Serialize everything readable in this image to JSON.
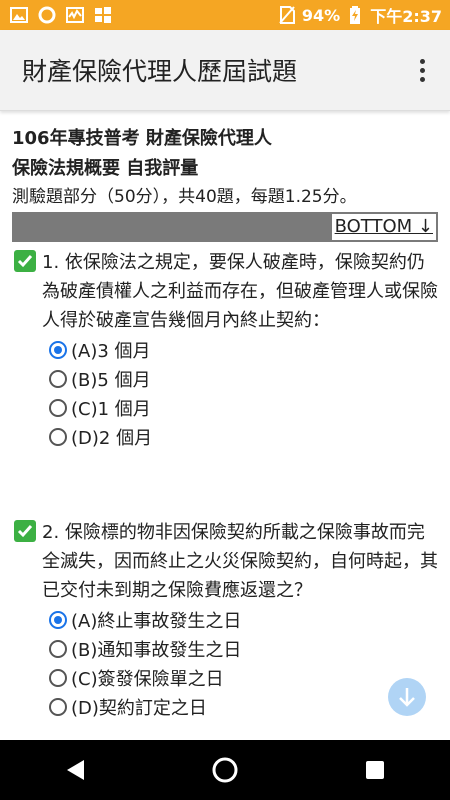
{
  "status": {
    "battery": "94%",
    "time": "下午2:37"
  },
  "app_bar": {
    "title": "財產保險代理人歷屆試題"
  },
  "exam": {
    "title": "106年專技普考 財產保險代理人",
    "subject": "保險法規概要 自我評量",
    "info": "測驗題部分（50分），共40題，每題1.25分。",
    "bottom_link": "BOTTOM ↓"
  },
  "questions": [
    {
      "text": "1. 依保險法之規定，要保人破產時，保險契約仍為破產債權人之利益而存在，但破產管理人或保險人得於破產宣告幾個月內終止契約：",
      "options": [
        "(A)3 個月",
        "(B)5 個月",
        "(C)1 個月",
        "(D)2 個月"
      ],
      "selected": 0
    },
    {
      "text": "2. 保險標的物非因保險契約所載之保險事故而完全滅失，因而終止之火災保險契約，自何時起，其已交付未到期之保險費應返還之？",
      "options": [
        "(A)終止事故發生之日",
        "(B)通知事故發生之日",
        "(C)簽發保險單之日",
        "(D)契約訂定之日"
      ],
      "selected": 0
    }
  ],
  "colors": {
    "status_bar": "#f5a623",
    "check": "#3cb043",
    "radio_on": "#1a73e8"
  }
}
